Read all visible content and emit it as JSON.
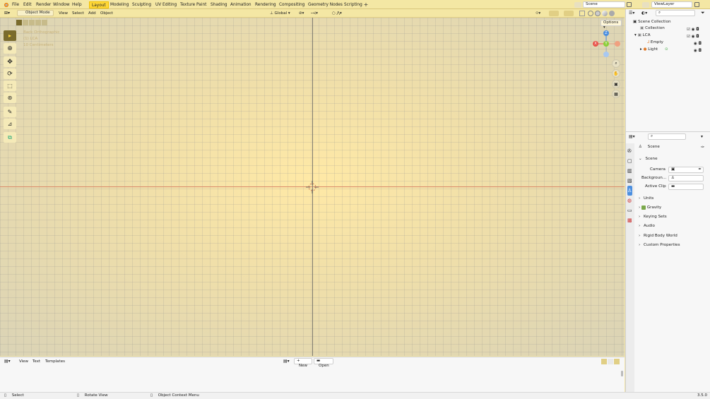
{
  "menu": [
    "File",
    "Edit",
    "Render",
    "Window",
    "Help"
  ],
  "workspaces": [
    "Layout",
    "Modeling",
    "Sculpting",
    "UV Editing",
    "Texture Paint",
    "Shading",
    "Animation",
    "Rendering",
    "Compositing",
    "Geometry Nodes",
    "Scripting"
  ],
  "active_workspace": "Layout",
  "scene_field": "Scene",
  "viewlayer_field": "ViewLayer",
  "viewport_header": {
    "mode": "Object Mode",
    "menus": [
      "View",
      "Select",
      "Add",
      "Object"
    ],
    "orientation": "Global",
    "options": "Options"
  },
  "viewport_overlay": {
    "line1": "Back Orthographic",
    "line2": "(1) LCA",
    "line3": "10 Centimeters"
  },
  "gizmo": {
    "z": "Z",
    "y": "Y",
    "x": "X"
  },
  "outliner": {
    "root": "Scene Collection",
    "items": [
      {
        "label": "Collection"
      },
      {
        "label": "LCA"
      },
      {
        "label": "Empty"
      },
      {
        "label": "Light"
      }
    ]
  },
  "properties": {
    "header": "Scene",
    "section": "Scene",
    "camera_label": "Camera",
    "background_label": "Backgroun...",
    "active_clip_label": "Active Clip",
    "panels": [
      "Units",
      "Gravity",
      "Keying Sets",
      "Audio",
      "Rigid Body World",
      "Custom Properties"
    ]
  },
  "text_editor": {
    "menus": [
      "View",
      "Text",
      "Templates"
    ],
    "new_label": "New",
    "open_label": "Open"
  },
  "statusbar": {
    "select": "Select",
    "rotate": "Rotate View",
    "context": "Object Context Menu",
    "version": "3.5.0"
  },
  "colors": {
    "accent": "#ffd83a",
    "x_axis": "#e8544c",
    "y_axis": "#8ccf3a",
    "z_axis": "#4b8fe0"
  }
}
